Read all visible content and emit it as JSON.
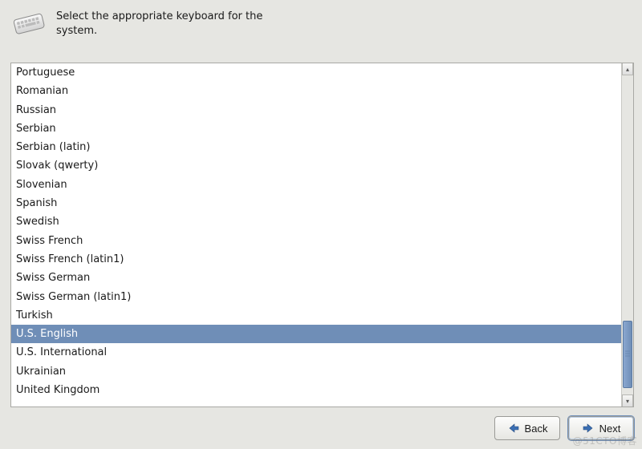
{
  "header": {
    "instruction": "Select the appropriate keyboard for the system."
  },
  "keyboard_list": {
    "selected_index": 14,
    "items": [
      "Portuguese",
      "Romanian",
      "Russian",
      "Serbian",
      "Serbian (latin)",
      "Slovak (qwerty)",
      "Slovenian",
      "Spanish",
      "Swedish",
      "Swiss French",
      "Swiss French (latin1)",
      "Swiss German",
      "Swiss German (latin1)",
      "Turkish",
      "U.S. English",
      "U.S. International",
      "Ukrainian",
      "United Kingdom"
    ]
  },
  "footer": {
    "back_label": "Back",
    "next_label": "Next"
  },
  "colors": {
    "selection": "#6f8eb7",
    "page_bg": "#e6e6e2"
  },
  "watermark": "@51CTO博客"
}
